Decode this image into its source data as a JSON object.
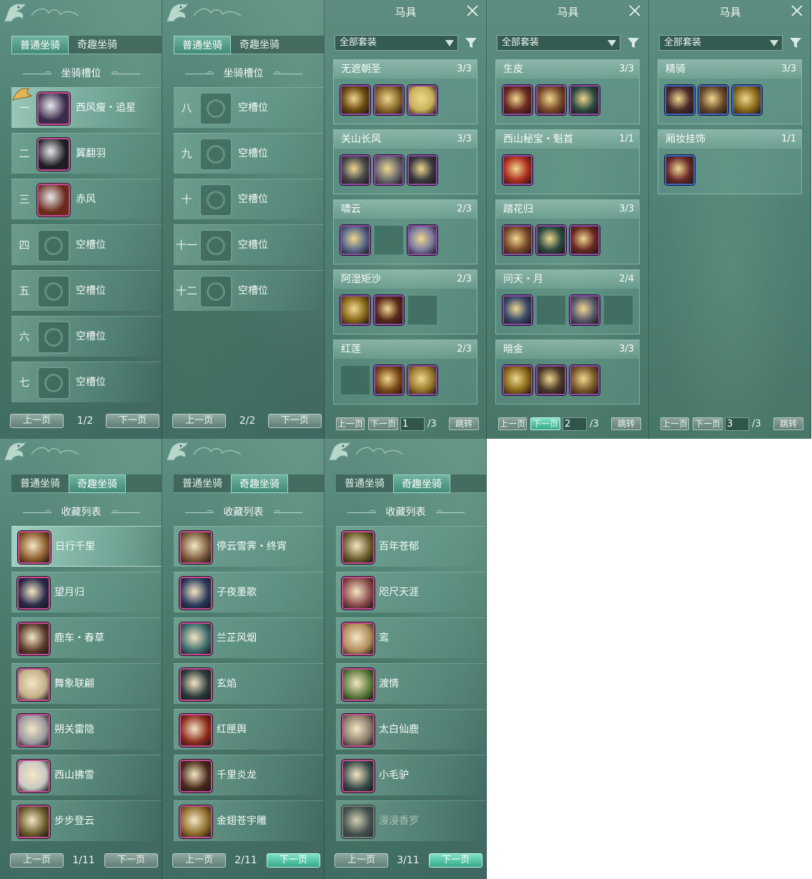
{
  "tabs": {
    "normal": "普通坐骑",
    "fun": "奇趣坐骑"
  },
  "mount_slots_title": "坐骑槽位",
  "collection_title": "收藏列表",
  "pager": {
    "prev": "上一页",
    "next": "下一页",
    "jump": "跳转"
  },
  "mount_pages": [
    {
      "page_text": "1/2",
      "rows": [
        {
          "num": "一",
          "name": "西风瘦・追星",
          "empty": false,
          "color": "#3a2b4a"
        },
        {
          "num": "二",
          "name": "翼翻羽",
          "empty": false,
          "color": "#1d1d24"
        },
        {
          "num": "三",
          "name": "赤风",
          "empty": false,
          "color": "#6a2a1a"
        },
        {
          "num": "四",
          "name": "空槽位",
          "empty": true
        },
        {
          "num": "五",
          "name": "空槽位",
          "empty": true
        },
        {
          "num": "六",
          "name": "空槽位",
          "empty": true
        },
        {
          "num": "七",
          "name": "空槽位",
          "empty": true
        }
      ]
    },
    {
      "page_text": "2/2",
      "rows": [
        {
          "num": "八",
          "name": "空槽位",
          "empty": true
        },
        {
          "num": "九",
          "name": "空槽位",
          "empty": true
        },
        {
          "num": "十",
          "name": "空槽位",
          "empty": true
        },
        {
          "num": "十一",
          "name": "空槽位",
          "empty": true
        },
        {
          "num": "十二",
          "name": "空槽位",
          "empty": true
        }
      ]
    }
  ],
  "gear": {
    "title": "马具",
    "filter": "全部套装",
    "pages": [
      {
        "page_num": "1",
        "page_total": "/3",
        "sets": [
          {
            "name": "无遮朝圣",
            "count": "3/3",
            "items": [
              "#6b4b12",
              "#8a6a2a",
              "#c9b25a"
            ]
          },
          {
            "name": "关山长风",
            "count": "3/3",
            "items": [
              "#4a4a4e",
              "#6c6c70",
              "#3a3a3e"
            ]
          },
          {
            "name": "啸云",
            "count": "2/3",
            "items": [
              "#5a6a8a",
              "",
              "#7a7aa0"
            ]
          },
          {
            "name": "阿湿矩沙",
            "count": "2/3",
            "items": [
              "#8a6a1a",
              "#5a2a1a",
              ""
            ]
          },
          {
            "name": "红莲",
            "count": "2/3",
            "items": [
              "",
              "#7a4a1a",
              "#9a7a2a"
            ]
          }
        ]
      },
      {
        "page_num": "2",
        "page_total": "/3",
        "sets": [
          {
            "name": "生皮",
            "count": "3/3",
            "items": [
              "#6a2a20",
              "#7a4a2a",
              "#2a4a40"
            ]
          },
          {
            "name": "西山秘宝・魁首",
            "count": "1/1",
            "items": [
              "#b03020"
            ]
          },
          {
            "name": "踏花归",
            "count": "3/3",
            "items": [
              "#7a4a2a",
              "#2a4a40",
              "#6a2a20"
            ]
          },
          {
            "name": "问天・月",
            "count": "2/4",
            "items": [
              "#3a4a6a",
              "",
              "#5a5a6a",
              ""
            ]
          },
          {
            "name": "暗金",
            "count": "3/3",
            "items": [
              "#8a6a1a",
              "#4a3a2a",
              "#7a5a2a"
            ]
          }
        ]
      },
      {
        "page_num": "3",
        "page_total": "/3",
        "sets": [
          {
            "name": "精骑",
            "count": "3/3",
            "items": [
              "#4a2a2a",
              "#6a4a2a",
              "#8a6a1a"
            ]
          },
          {
            "name": "厢妆挂饰",
            "count": "1/1",
            "items": [
              "#6a2a2a"
            ]
          }
        ]
      }
    ]
  },
  "collection_pages": [
    {
      "page_text": "1/11",
      "rows": [
        {
          "name": "日行千里",
          "color": "#8a5a2a"
        },
        {
          "name": "望月归",
          "color": "#2a2a4a"
        },
        {
          "name": "鹿车・春草",
          "color": "#5a3a2a"
        },
        {
          "name": "舞象联翩",
          "color": "#c4b08a"
        },
        {
          "name": "朔关雷隐",
          "color": "#9a9aa0"
        },
        {
          "name": "西山拂雪",
          "color": "#c9c9c4"
        },
        {
          "name": "步步登云",
          "color": "#6a5a2a"
        }
      ]
    },
    {
      "page_text": "2/11",
      "rows": [
        {
          "name": "停云雪霁・终宵",
          "color": "#7a5a3a"
        },
        {
          "name": "子夜墨歌",
          "color": "#2a3a5a"
        },
        {
          "name": "兰芷风烟",
          "color": "#3a6a6a"
        },
        {
          "name": "玄焰",
          "color": "#2a3a3a"
        },
        {
          "name": "红匣舆",
          "color": "#8a2a1a"
        },
        {
          "name": "千里炎龙",
          "color": "#4a2a1a"
        },
        {
          "name": "金翅苍宇雕",
          "color": "#8a6a2a"
        }
      ]
    },
    {
      "page_text": "3/11",
      "rows": [
        {
          "name": "百年苍郁",
          "color": "#6a5a2a",
          "dim": false
        },
        {
          "name": "咫尺天涯",
          "color": "#8a4a4a",
          "dim": false
        },
        {
          "name": "鸾",
          "color": "#b08a5a",
          "dim": false
        },
        {
          "name": "渡情",
          "color": "#5a7a3a",
          "dim": false
        },
        {
          "name": "太白仙鹿",
          "color": "#8a7a6a",
          "dim": false
        },
        {
          "name": "小毛驴",
          "color": "#3a4a4a",
          "dim": false
        },
        {
          "name": "漫漫香罗",
          "color": "#3a3a3a",
          "dim": true
        }
      ]
    }
  ]
}
